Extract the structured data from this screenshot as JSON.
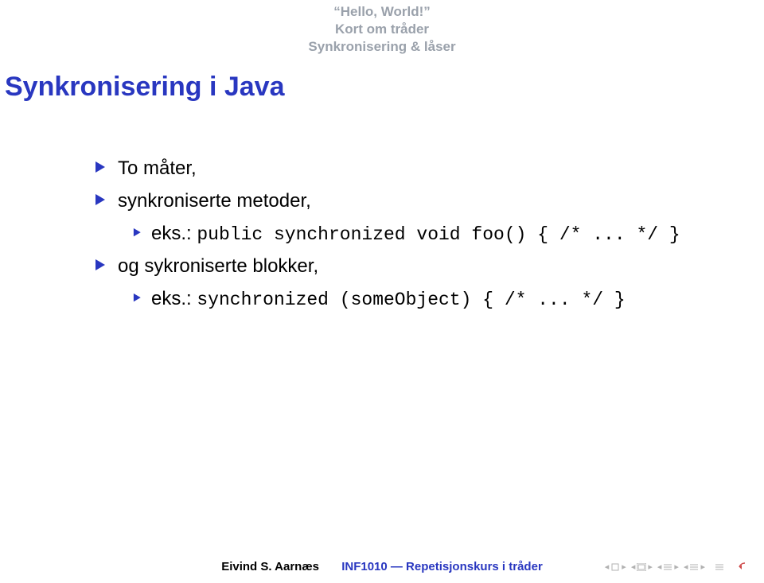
{
  "header": {
    "line1": "“Hello, World!”",
    "line2": "Kort om tråder",
    "line3": "Synkronisering & låser"
  },
  "title": "Synkronisering i Java",
  "bullets": {
    "b1": "To måter,",
    "b2": "synkroniserte metoder,",
    "b2a_prefix": "eks.: ",
    "b2a_code": "public synchronized void foo() { /* ... */ }",
    "b3": "og sykroniserte blokker,",
    "b3a_prefix": "eks.: ",
    "b3a_code": "synchronized (someObject) { /* ... */ }"
  },
  "footer": {
    "author": "Eivind S. Aarnæs",
    "course": "INF1010 — Repetisjonskurs i tråder"
  }
}
